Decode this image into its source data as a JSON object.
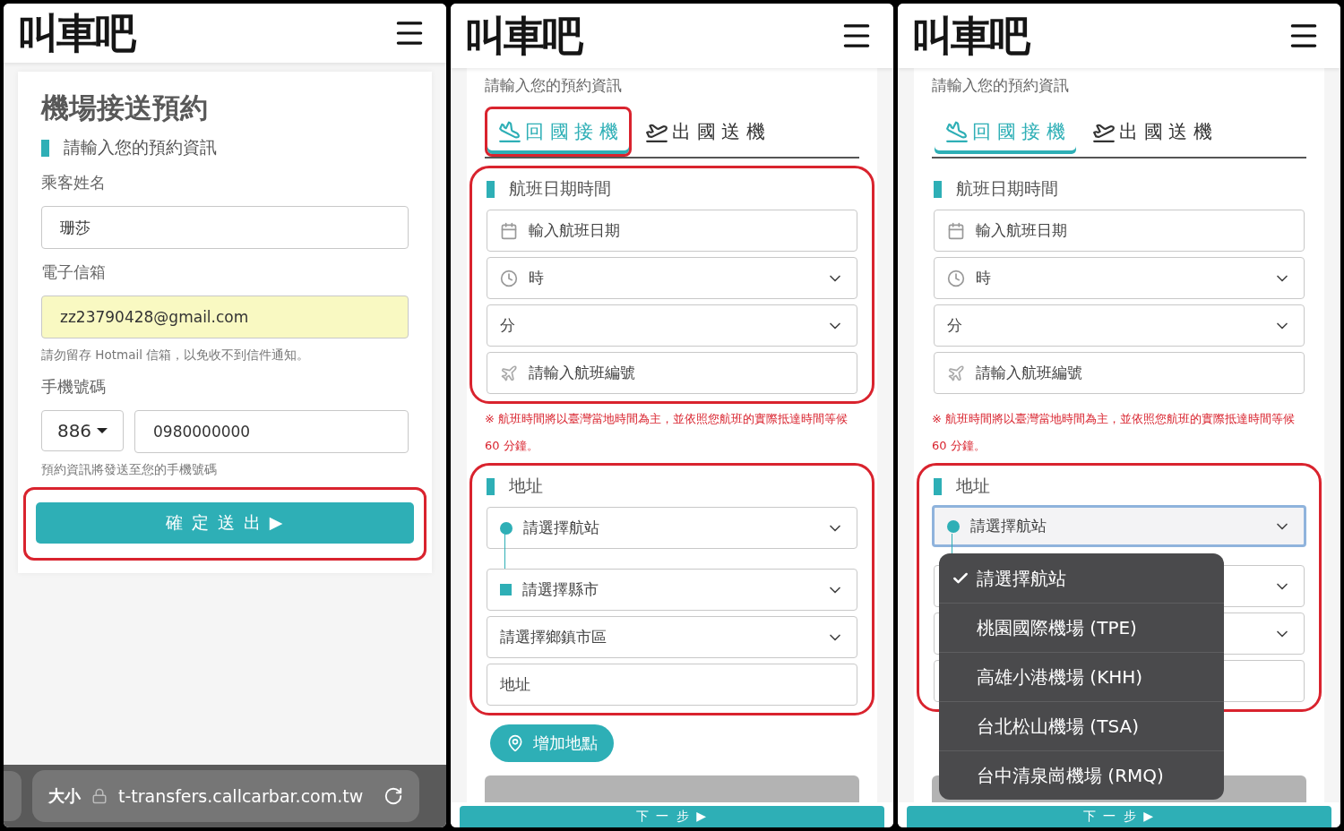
{
  "panels": [
    {
      "kind": "contact",
      "logo": "叫車吧",
      "title": "機場接送預約",
      "section_title": "請輸入您的預約資訊",
      "name_label": "乘客姓名",
      "name_value": "珊莎",
      "email_label": "電子信箱",
      "email_value": "zz23790428@gmail.com",
      "email_autofilled": true,
      "email_hint": "請勿留存 Hotmail 信箱，以免收不到信件通知。",
      "phone_label": "手機號碼",
      "country_code": "886",
      "phone_value": "0980000000",
      "phone_hint": "預約資訊將發送至您的手機號碼",
      "submit": {
        "label": "確 定 送 出 ▶",
        "highlighted": true
      },
      "browser_bar": {
        "text_size": "大小",
        "url": "t-transfers.callcarbar.com.tw"
      }
    },
    {
      "kind": "booking",
      "logo": "叫車吧",
      "intro": "請輸入您的預約資訊",
      "tabs": [
        {
          "kind": "arrival",
          "label": "回 國 接 機",
          "selected": true,
          "highlighted": true
        },
        {
          "kind": "departure",
          "label": "出 國 送 機",
          "selected": false,
          "highlighted": false
        }
      ],
      "flight": {
        "title": "航班日期時間",
        "highlighted": true,
        "fields": [
          {
            "kind": "date",
            "placeholder": "輸入航班日期"
          },
          {
            "kind": "hour",
            "placeholder": "時"
          },
          {
            "kind": "select",
            "placeholder": "分"
          },
          {
            "kind": "flight_no",
            "placeholder": "請輸入航班編號"
          }
        ]
      },
      "note": "※ 航班時間將以臺灣當地時間為主，並依照您航班的實際抵達時間等候 60 分鐘。",
      "address": {
        "title": "地址",
        "highlighted": true,
        "fields": [
          {
            "kind": "station",
            "placeholder": "請選擇航站",
            "focused": false
          },
          {
            "kind": "city",
            "placeholder": "請選擇縣市"
          },
          {
            "kind": "select",
            "placeholder": "請選擇鄉鎮市區"
          },
          {
            "kind": "text",
            "placeholder": "地址"
          }
        ]
      },
      "add_location": "增加地點",
      "next": "下 一 步 ▶"
    },
    {
      "kind": "booking",
      "logo": "叫車吧",
      "intro": "請輸入您的預約資訊",
      "tabs": [
        {
          "kind": "arrival",
          "label": "回 國 接 機",
          "selected": true,
          "highlighted": false
        },
        {
          "kind": "departure",
          "label": "出 國 送 機",
          "selected": false,
          "highlighted": false
        }
      ],
      "flight": {
        "title": "航班日期時間",
        "highlighted": false,
        "fields": [
          {
            "kind": "date",
            "placeholder": "輸入航班日期"
          },
          {
            "kind": "hour",
            "placeholder": "時"
          },
          {
            "kind": "select",
            "placeholder": "分"
          },
          {
            "kind": "flight_no",
            "placeholder": "請輸入航班編號"
          }
        ]
      },
      "note": "※ 航班時間將以臺灣當地時間為主，並依照您航班的實際抵達時間等候 60 分鐘。",
      "address": {
        "title": "地址",
        "highlighted": true,
        "fields": [
          {
            "kind": "station",
            "placeholder": "請選擇航站",
            "focused": true
          },
          {
            "kind": "city"
          },
          {
            "kind": "select"
          },
          {
            "kind": "text"
          }
        ]
      },
      "menu": [
        {
          "label": "請選擇航站",
          "selected": true
        },
        {
          "label": "桃園國際機場 (TPE)",
          "selected": false
        },
        {
          "label": "高雄小港機場 (KHH)",
          "selected": false
        },
        {
          "label": "台北松山機場 (TSA)",
          "selected": false
        },
        {
          "label": "台中清泉崗機場 (RMQ)",
          "selected": false
        }
      ],
      "next": "下 一 步 ▶"
    }
  ]
}
